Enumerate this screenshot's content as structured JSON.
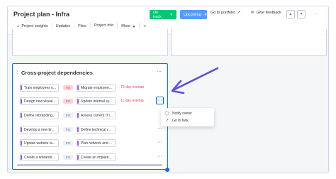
{
  "header": {
    "title": "Project plan - Infra",
    "status_pill": "On track",
    "stage_pill": "Upcoming",
    "portfolio_label": "Go to portfolio",
    "feedback_label": "Give feedback"
  },
  "tabs": [
    {
      "label": "Project insights"
    },
    {
      "label": "Updates"
    },
    {
      "label": "Files"
    },
    {
      "label": "Project info"
    },
    {
      "label": "More"
    }
  ],
  "dependencies_widget": {
    "title": "Cross-project dependencies",
    "rows": [
      {
        "from": "Train employees o...",
        "relation": "FS",
        "to": "Migrate employee...",
        "overlap": "76-day overlap",
        "highlight": true
      },
      {
        "from": "Design new visual...",
        "relation": "FS",
        "to": "Update internal sy...",
        "overlap": "11-day overlap",
        "highlight": true
      },
      {
        "from": "Define rebranding...",
        "relation": "FS",
        "to": "Assess current IT i...",
        "overlap": "",
        "highlight": false
      },
      {
        "from": "Develop a new br...",
        "relation": "FS",
        "to": "Define technical r...",
        "overlap": "",
        "highlight": false
      },
      {
        "from": "Update website la...",
        "relation": "FS",
        "to": "Plan network and ...",
        "overlap": "",
        "highlight": false
      },
      {
        "from": "Create a rebrandi...",
        "relation": "FS",
        "to": "Create an implem...",
        "overlap": "",
        "highlight": false
      }
    ]
  },
  "row_menu": {
    "items": [
      {
        "label": "Notify owner",
        "icon": "chat-bubble-icon"
      },
      {
        "label": "Go to task",
        "icon": "external-link-icon"
      }
    ]
  },
  "colors": {
    "accent": "#0073ea",
    "status_green": "#00c875",
    "stage_blue": "#579bfc",
    "overlap_red": "#e2445c",
    "annotation_arrow": "#5b4fd6"
  }
}
